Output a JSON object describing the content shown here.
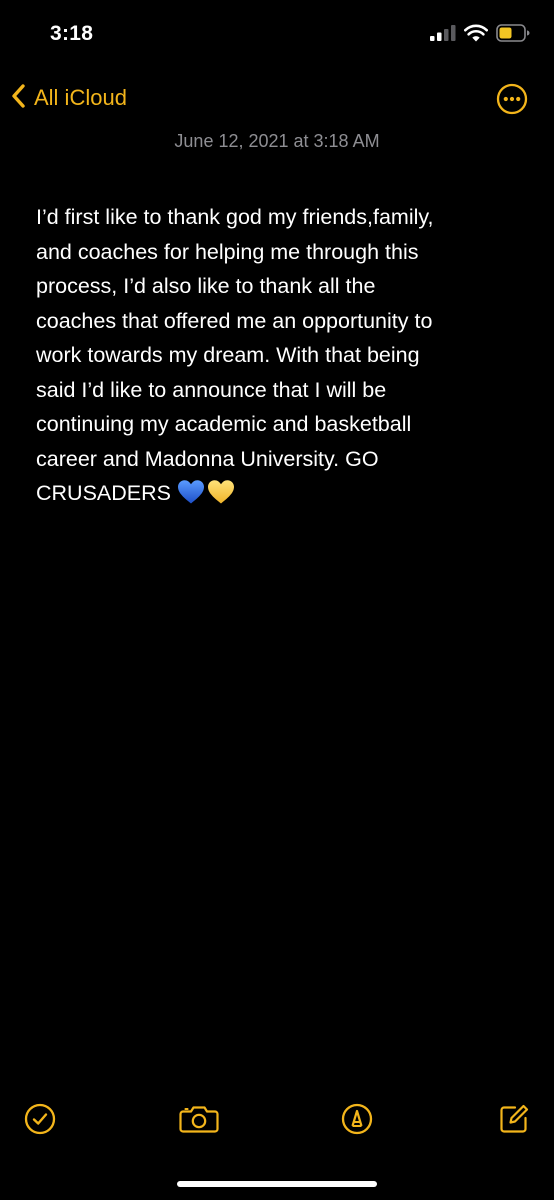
{
  "status_bar": {
    "time": "3:18",
    "icons": [
      "cellular-signal-icon",
      "wifi-icon",
      "battery-icon"
    ]
  },
  "nav": {
    "back_label": "All iCloud",
    "back_icon": "chevron-left-icon",
    "more_icon": "ellipsis-circle-icon"
  },
  "note": {
    "date": "June 12, 2021 at 3:18 AM",
    "body": "I’d first like to thank god my friends,family,\nand coaches for helping me through this\nprocess, I’d also like to thank all the\ncoaches that offered me an opportunity to\nwork towards my dream. With that being\nsaid I’d like to announce that I will be\ncontinuing my academic and basketball\ncareer and Madonna University. GO\nCRUSADERS",
    "emojis": [
      "blue-heart-icon",
      "yellow-heart-icon"
    ]
  },
  "toolbar": {
    "items": [
      "checklist-icon",
      "camera-icon",
      "markup-pen-icon",
      "compose-icon"
    ]
  },
  "colors": {
    "accent": "#f3b51b",
    "background": "#000000",
    "text": "#ffffff",
    "secondary_text": "#8e8e93",
    "blue_heart": "#2f6fe0",
    "yellow_heart": "#f6c744"
  }
}
